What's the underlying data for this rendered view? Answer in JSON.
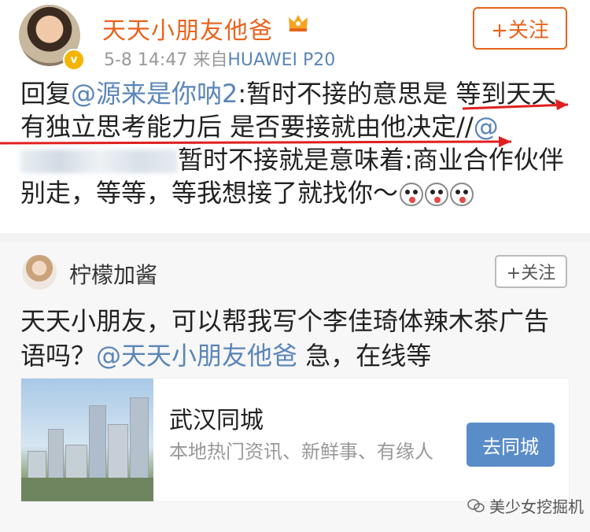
{
  "post": {
    "username": "天天小朋友他爸",
    "time": "5-8 14:47",
    "source_prefix": " 来自",
    "source": "HUAWEI P20",
    "follow_label": "+关注",
    "reply_prefix": "回复",
    "mention": "@源来是你呐2",
    "text_a": ":暂时不接的意思是 等到天天有独立思考能力后 是否要接就由他决定//",
    "mention2": "@",
    "text_b": "暂时不接就是意味着:商业合作伙伴别走，等等，等我想接了就找你～",
    "badge": "v"
  },
  "comment": {
    "username": "柠檬加酱",
    "follow_label": "+关注",
    "text_a": "天天小朋友，可以帮我写个李佳琦体辣木茶广告语吗？",
    "mention": "@天天小朋友他爸",
    "text_b": " 急，在线等"
  },
  "card": {
    "title": "武汉同城",
    "desc": "本地热门资讯、新鲜事、有缘人",
    "button": "去同城"
  },
  "watermark": "美少女挖掘机",
  "colors": {
    "accent": "#e8631c",
    "link": "#5b86b8",
    "annotation": "#e02020",
    "button": "#5a8dc8"
  }
}
